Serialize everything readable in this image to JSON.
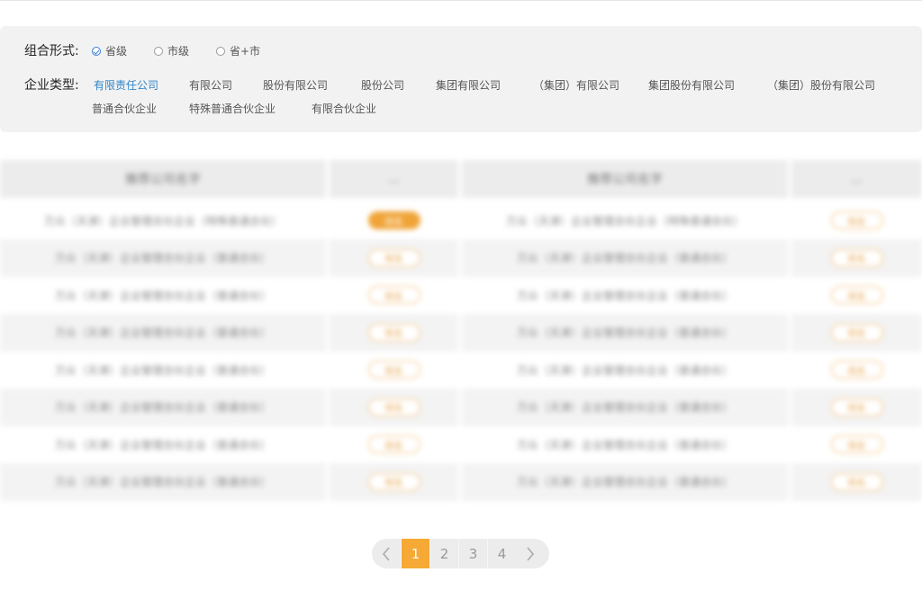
{
  "filters": {
    "combo_label": "组合形式:",
    "combo_options": [
      {
        "label": "省级",
        "checked": true
      },
      {
        "label": "市级",
        "checked": false
      },
      {
        "label": "省+市",
        "checked": false
      }
    ],
    "type_label": "企业类型:",
    "type_options": [
      {
        "label": "有限责任公司",
        "active": true
      },
      {
        "label": "有限公司",
        "active": false
      },
      {
        "label": "股份有限公司",
        "active": false
      },
      {
        "label": "股份公司",
        "active": false
      },
      {
        "label": "集团有限公司",
        "active": false
      },
      {
        "label": "（集团）有限公司",
        "active": false
      },
      {
        "label": "集团股份有限公司",
        "active": false
      },
      {
        "label": "（集团）股份有限公司",
        "active": false
      },
      {
        "label": "普通合伙企业",
        "active": false
      },
      {
        "label": "特殊普通合伙企业",
        "active": false
      },
      {
        "label": "有限合伙企业",
        "active": false
      }
    ]
  },
  "table": {
    "headers": [
      "推荐公司名字",
      "...",
      "推荐公司名字",
      "..."
    ],
    "rows": [
      {
        "left": "万众（天津）企业管理合伙企业（特殊普通合伙）",
        "right": "万众（天津）企业管理合伙企业（特殊普通合伙）",
        "tag_left": "核名",
        "tag_right": "核名"
      },
      {
        "left": "万众（天津）企业管理合伙企业（普通合伙）",
        "right": "万众（天津）企业管理合伙企业（普通合伙）",
        "tag_left": "核名",
        "tag_right": "核名"
      },
      {
        "left": "万众（天津）企业管理合伙企业（普通合伙）",
        "right": "万众（天津）企业管理合伙企业（普通合伙）",
        "tag_left": "核名",
        "tag_right": "核名"
      },
      {
        "left": "万众（天津）企业管理合伙企业（普通合伙）",
        "right": "万众（天津）企业管理合伙企业（普通合伙）",
        "tag_left": "核名",
        "tag_right": "核名"
      },
      {
        "left": "万众（天津）企业管理合伙企业（普通合伙）",
        "right": "万众（天津）企业管理合伙企业（普通合伙）",
        "tag_left": "核名",
        "tag_right": "核名"
      },
      {
        "left": "万众（天津）企业管理合伙企业（普通合伙）",
        "right": "万众（天津）企业管理合伙企业（普通合伙）",
        "tag_left": "核名",
        "tag_right": "核名"
      },
      {
        "left": "万众（天津）企业管理合伙企业（普通合伙）",
        "right": "万众（天津）企业管理合伙企业（普通合伙）",
        "tag_left": "核名",
        "tag_right": "核名"
      },
      {
        "left": "万众（天津）企业管理合伙企业（普通合伙）",
        "right": "万众（天津）企业管理合伙企业（普通合伙）",
        "tag_left": "核名",
        "tag_right": "核名"
      }
    ]
  },
  "pagination": {
    "pages": [
      "1",
      "2",
      "3",
      "4"
    ],
    "current": "1"
  },
  "colors": {
    "accent_orange": "#f6a934",
    "link_blue": "#2f86c9",
    "panel_bg": "#f2f2f2"
  },
  "icons": {
    "prev": "chevron-left-icon",
    "next": "chevron-right-icon",
    "checked": "check-circle-icon",
    "unchecked": "radio-empty-icon"
  }
}
